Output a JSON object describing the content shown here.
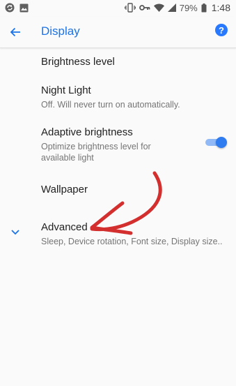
{
  "status_bar": {
    "battery_percent": "79%",
    "time": "1:48",
    "icons": [
      "sync-icon",
      "image-icon",
      "vibrate-icon",
      "key-icon",
      "wifi-icon",
      "signal-icon",
      "battery-icon"
    ]
  },
  "app_bar": {
    "title": "Display",
    "back_icon": "arrow-left-icon",
    "help_icon": "help-icon",
    "help_glyph": "?",
    "accent_color": "#1a73e8"
  },
  "settings": {
    "brightness": {
      "title": "Brightness level"
    },
    "night_light": {
      "title": "Night Light",
      "summary": "Off. Will never turn on automatically."
    },
    "adaptive": {
      "title": "Adaptive brightness",
      "summary": "Optimize brightness level for available light",
      "enabled": true
    },
    "wallpaper": {
      "title": "Wallpaper"
    },
    "advanced": {
      "title": "Advanced",
      "summary": "Sleep, Device rotation, Font size, Display size..",
      "expand_icon": "chevron-down-icon"
    }
  },
  "annotation": {
    "color": "#d32f2f",
    "shape": "hand-drawn-arrow"
  }
}
